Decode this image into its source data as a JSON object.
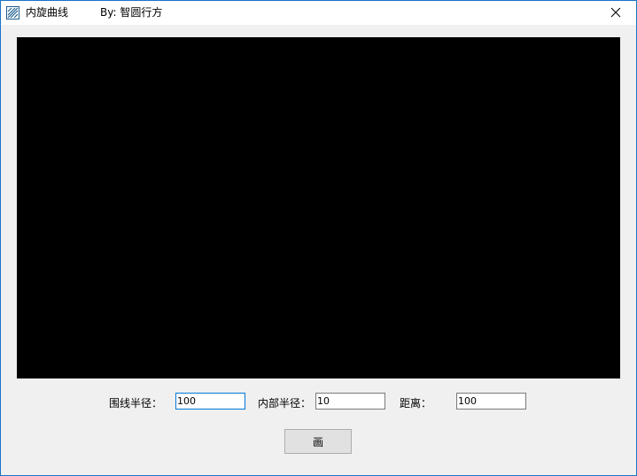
{
  "window": {
    "title": "内旋曲线",
    "author": "By: 智圆行方",
    "close_symbol": "✕",
    "icon": "app-logo-icon",
    "border_color": "#1a73c7"
  },
  "canvas": {
    "background_color": "#000000"
  },
  "controls": {
    "outer_radius_label": "围线半径：",
    "outer_radius_value": "100",
    "inner_radius_label": "内部半径：",
    "inner_radius_value": "10",
    "distance_label": "距离：",
    "distance_value": "100",
    "draw_button_label": "画"
  }
}
